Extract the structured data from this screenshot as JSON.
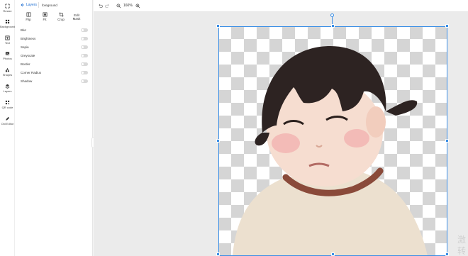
{
  "rail": {
    "items": [
      {
        "label": "Resize",
        "icon": "resize-icon"
      },
      {
        "label": "Background",
        "icon": "background-icon"
      },
      {
        "label": "Text",
        "icon": "text-icon"
      },
      {
        "label": "Photos",
        "icon": "photos-icon"
      },
      {
        "label": "Shapes",
        "icon": "shapes-icon"
      },
      {
        "label": "Layers",
        "icon": "layers-icon"
      },
      {
        "label": "QR code",
        "icon": "qr-code-icon"
      },
      {
        "label": "Old Editor",
        "icon": "old-editor-icon"
      }
    ]
  },
  "panel": {
    "back_label": "Layers",
    "crumb": "foreground",
    "tools": [
      {
        "label": "Flip",
        "icon": "flip-icon"
      },
      {
        "label": "Fit",
        "icon": "fit-icon"
      },
      {
        "label": "Crop",
        "icon": "crop-icon"
      },
      {
        "label": "Edit Mask",
        "icon": "edit-mask-icon"
      }
    ],
    "options": [
      "Blur",
      "Brightness",
      "Sepia",
      "Greyscale",
      "Border",
      "Corner Radius",
      "Shadow"
    ]
  },
  "toolbar": {
    "zoom": "160%"
  },
  "canvas": {
    "watermark_top": "激",
    "watermark_bottom": "转"
  },
  "colors": {
    "accent": "#3a8ee6",
    "link": "#1f6fd1"
  }
}
